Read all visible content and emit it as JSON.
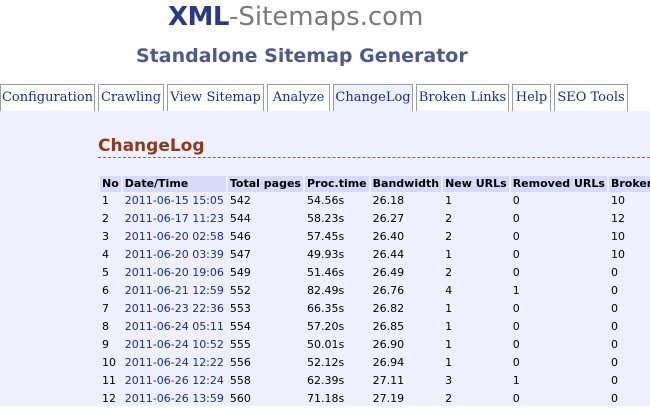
{
  "brand": {
    "name_bold": "XML",
    "name_rest": "-Sitemaps.com",
    "subtitle": "Standalone Sitemap Generator"
  },
  "tabs": [
    {
      "label": "Configuration"
    },
    {
      "label": "Crawling"
    },
    {
      "label": "View Sitemap"
    },
    {
      "label": "Analyze"
    },
    {
      "label": "ChangeLog",
      "active": true
    },
    {
      "label": "Broken Links"
    },
    {
      "label": "Help"
    },
    {
      "label": "SEO Tools"
    }
  ],
  "main": {
    "title": "ChangeLog",
    "table": {
      "headers": [
        "No",
        "Date/Time",
        "Total pages",
        "Proc.time",
        "Bandwidth",
        "New URLs",
        "Removed URLs",
        "Broken li"
      ],
      "rows": [
        [
          "1",
          "2011-06-15 15:05",
          "542",
          "54.56s",
          "26.18",
          "1",
          "0",
          "10"
        ],
        [
          "2",
          "2011-06-17 11:23",
          "544",
          "58.23s",
          "26.27",
          "2",
          "0",
          "12"
        ],
        [
          "3",
          "2011-06-20 02:58",
          "546",
          "57.45s",
          "26.40",
          "2",
          "0",
          "10"
        ],
        [
          "4",
          "2011-06-20 03:39",
          "547",
          "49.93s",
          "26.44",
          "1",
          "0",
          "10"
        ],
        [
          "5",
          "2011-06-20 19:06",
          "549",
          "51.46s",
          "26.49",
          "2",
          "0",
          "0"
        ],
        [
          "6",
          "2011-06-21 12:59",
          "552",
          "82.49s",
          "26.76",
          "4",
          "1",
          "0"
        ],
        [
          "7",
          "2011-06-23 22:36",
          "553",
          "66.35s",
          "26.82",
          "1",
          "0",
          "0"
        ],
        [
          "8",
          "2011-06-24 05:11",
          "554",
          "57.20s",
          "26.85",
          "1",
          "0",
          "0"
        ],
        [
          "9",
          "2011-06-24 10:52",
          "555",
          "50.01s",
          "26.90",
          "1",
          "0",
          "0"
        ],
        [
          "10",
          "2011-06-24 12:22",
          "556",
          "52.12s",
          "26.94",
          "1",
          "0",
          "0"
        ],
        [
          "11",
          "2011-06-26 12:24",
          "558",
          "62.39s",
          "27.11",
          "3",
          "1",
          "0"
        ],
        [
          "12",
          "2011-06-26 13:59",
          "560",
          "71.18s",
          "27.19",
          "2",
          "0",
          "0"
        ]
      ]
    }
  },
  "colors": {
    "brand_blue": "#2b3a86",
    "link_blue": "#1a2f8a",
    "title_brown": "#8b3a1a",
    "content_bg": "#eef0ff",
    "header_bg": "#d6d9f7"
  }
}
